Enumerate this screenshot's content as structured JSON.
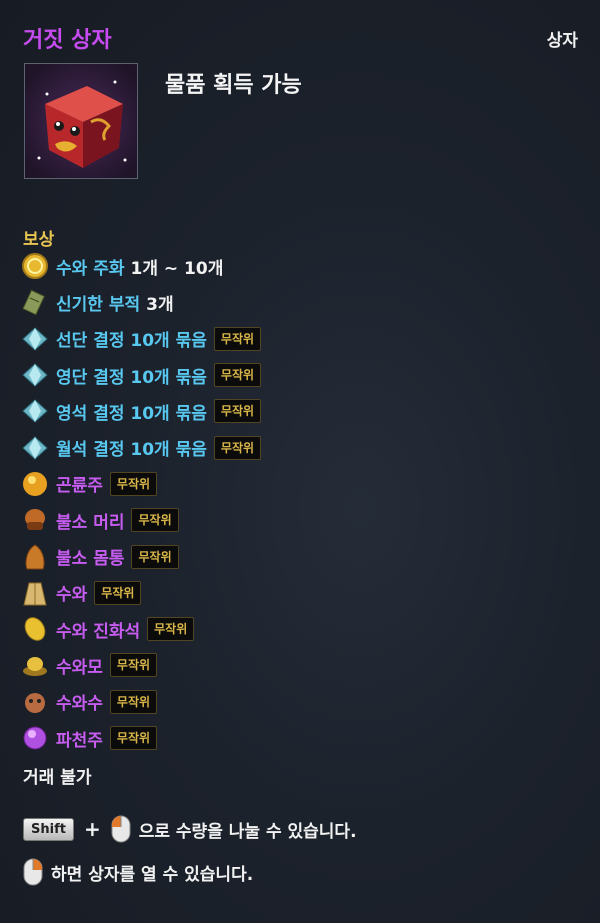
{
  "tooltip": {
    "title": "거짓 상자",
    "category": "상자",
    "obtain": "물품 획득 가능",
    "reward_header": "보상",
    "rewards": [
      {
        "icon": "coin-icon",
        "name": "수와 주화",
        "color": "cyan",
        "qty": "1개 ~ 10개",
        "badge": ""
      },
      {
        "icon": "talisman-icon",
        "name": "신기한 부적",
        "color": "cyan",
        "qty": "3개",
        "badge": ""
      },
      {
        "icon": "crystal-icon",
        "name": "선단 결정 10개 묶음",
        "color": "cyan",
        "qty": "",
        "badge": "무작위"
      },
      {
        "icon": "crystal-icon",
        "name": "영단 결정 10개 묶음",
        "color": "cyan",
        "qty": "",
        "badge": "무작위"
      },
      {
        "icon": "crystal-icon",
        "name": "영석 결정 10개 묶음",
        "color": "cyan",
        "qty": "",
        "badge": "무작위"
      },
      {
        "icon": "crystal-icon",
        "name": "월석 결정 10개 묶음",
        "color": "cyan",
        "qty": "",
        "badge": "무작위"
      },
      {
        "icon": "orb-icon",
        "name": "곤륜주",
        "color": "purple",
        "qty": "",
        "badge": "무작위"
      },
      {
        "icon": "helmet-icon",
        "name": "불소 머리",
        "color": "purple",
        "qty": "",
        "badge": "무작위"
      },
      {
        "icon": "armor-icon",
        "name": "불소 몸통",
        "color": "purple",
        "qty": "",
        "badge": "무작위"
      },
      {
        "icon": "costume-icon",
        "name": "수와",
        "color": "purple",
        "qty": "",
        "badge": "무작위"
      },
      {
        "icon": "evolution-stone-icon",
        "name": "수와 진화석",
        "color": "purple",
        "qty": "",
        "badge": "무작위"
      },
      {
        "icon": "hat-icon",
        "name": "수와모",
        "color": "purple",
        "qty": "",
        "badge": "무작위"
      },
      {
        "icon": "pet-icon",
        "name": "수와수",
        "color": "purple",
        "qty": "",
        "badge": "무작위"
      },
      {
        "icon": "gem-icon",
        "name": "파천주",
        "color": "purple",
        "qty": "",
        "badge": "무작위"
      }
    ],
    "trade": "거래 불가",
    "hint_split": {
      "key": "Shift",
      "plus": "+",
      "text": "으로 수량을 나눌 수 있습니다."
    },
    "hint_open": {
      "text": "하면 상자를 열 수 있습니다."
    },
    "colors": {
      "title": "#c64cf0",
      "cyan": "#58c8f0",
      "purple": "#c65cf0",
      "gold": "#e8c451"
    }
  }
}
